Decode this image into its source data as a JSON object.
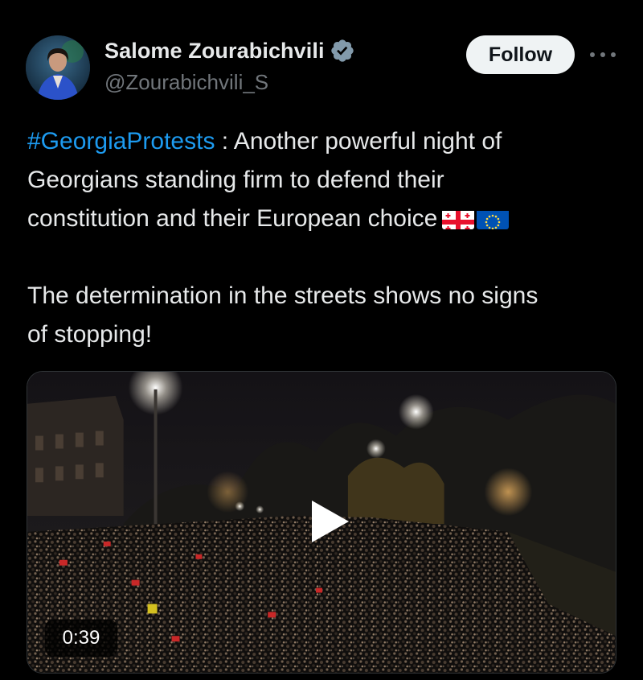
{
  "author": {
    "display_name": "Salome Zourabichvili",
    "handle": "@Zourabichvili_S",
    "verified": true,
    "avatar_icon": "profile-photo"
  },
  "actions": {
    "follow_label": "Follow",
    "more_icon": "more-horizontal-icon"
  },
  "tweet": {
    "hashtag": "#GeorgiaProtests",
    "line1_rest": " : Another powerful night of",
    "line2": "Georgians standing firm to defend their",
    "line3": "constitution and their European choice",
    "flags": [
      "georgia-flag-emoji",
      "eu-flag-emoji"
    ],
    "paragraph2_line1": "The determination in the streets shows no signs",
    "paragraph2_line2": "of stopping!"
  },
  "media": {
    "type": "video",
    "duration": "0:39",
    "play_icon": "play-icon"
  },
  "colors": {
    "background": "#000000",
    "text": "#e7e9ea",
    "secondary_text": "#71767b",
    "link": "#1d9bf0",
    "verified_badge": "#829aab",
    "follow_bg": "#eff3f4"
  }
}
